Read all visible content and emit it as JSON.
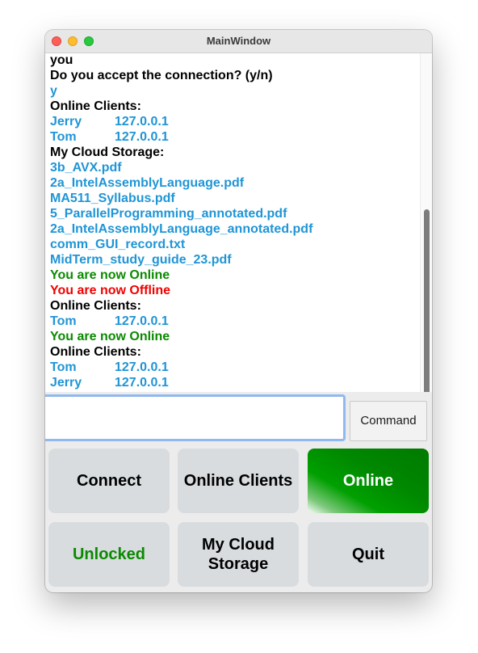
{
  "window": {
    "title": "MainWindow"
  },
  "log": {
    "lines": [
      {
        "kind": "text",
        "text": "you",
        "color": "black"
      },
      {
        "kind": "text",
        "text": "Do you accept the connection? (y/n)",
        "color": "black"
      },
      {
        "kind": "text",
        "text": "y",
        "color": "blue"
      },
      {
        "kind": "text",
        "text": "Online Clients:",
        "color": "black"
      },
      {
        "kind": "client",
        "name": "Jerry",
        "ip": "127.0.0.1",
        "color": "blue"
      },
      {
        "kind": "client",
        "name": "Tom",
        "ip": "127.0.0.1",
        "color": "blue"
      },
      {
        "kind": "text",
        "text": "My Cloud Storage:",
        "color": "black"
      },
      {
        "kind": "text",
        "text": "3b_AVX.pdf",
        "color": "blue"
      },
      {
        "kind": "text",
        "text": "2a_IntelAssemblyLanguage.pdf",
        "color": "blue"
      },
      {
        "kind": "text",
        "text": "MA511_Syllabus.pdf",
        "color": "blue"
      },
      {
        "kind": "text",
        "text": "5_ParallelProgramming_annotated.pdf",
        "color": "blue"
      },
      {
        "kind": "text",
        "text": "2a_IntelAssemblyLanguage_annotated.pdf",
        "color": "blue"
      },
      {
        "kind": "text",
        "text": "comm_GUI_record.txt",
        "color": "blue"
      },
      {
        "kind": "text",
        "text": "MidTerm_study_guide_23.pdf",
        "color": "blue"
      },
      {
        "kind": "text",
        "text": "You are now Online",
        "color": "green"
      },
      {
        "kind": "text",
        "text": "You are now Offline",
        "color": "red"
      },
      {
        "kind": "text",
        "text": "Online Clients:",
        "color": "black"
      },
      {
        "kind": "client",
        "name": "Tom",
        "ip": "127.0.0.1",
        "color": "blue"
      },
      {
        "kind": "text",
        "text": "You are now Online",
        "color": "green"
      },
      {
        "kind": "text",
        "text": "Online Clients:",
        "color": "black"
      },
      {
        "kind": "client",
        "name": "Tom",
        "ip": "127.0.0.1",
        "color": "blue"
      },
      {
        "kind": "client",
        "name": "Jerry",
        "ip": "127.0.0.1",
        "color": "blue"
      }
    ]
  },
  "command": {
    "input_value": "",
    "button_label": "Command"
  },
  "buttons": {
    "connect": "Connect",
    "online_clients": "Online Clients",
    "online": "Online",
    "unlocked": "Unlocked",
    "cloud_line1": "My Cloud",
    "cloud_line2": "Storage",
    "quit": "Quit"
  },
  "colors": {
    "log_black": "#000000",
    "log_blue": "#1f95d6",
    "log_green": "#0a8a00",
    "log_red": "#f20000",
    "online_button": "#008800",
    "button_bg": "#d8dcdf",
    "input_focus": "#8fb9ef"
  }
}
